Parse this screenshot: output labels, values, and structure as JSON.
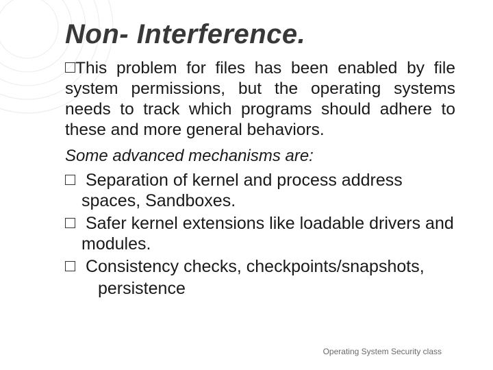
{
  "title": "Non- Interference.",
  "paragraph": "This problem for files has been enabled by file system permissions, but the operating systems needs to track which programs should adhere to these and more general behaviors.",
  "subheading": "Some advanced mechanisms are:",
  "bullets": [
    "Separation of kernel and process address spaces, Sandboxes.",
    "Safer kernel extensions like loadable drivers and modules.",
    "Consistency checks, checkpoints/snapshots,"
  ],
  "last_line": "persistence",
  "footer": "Operating System Security class"
}
